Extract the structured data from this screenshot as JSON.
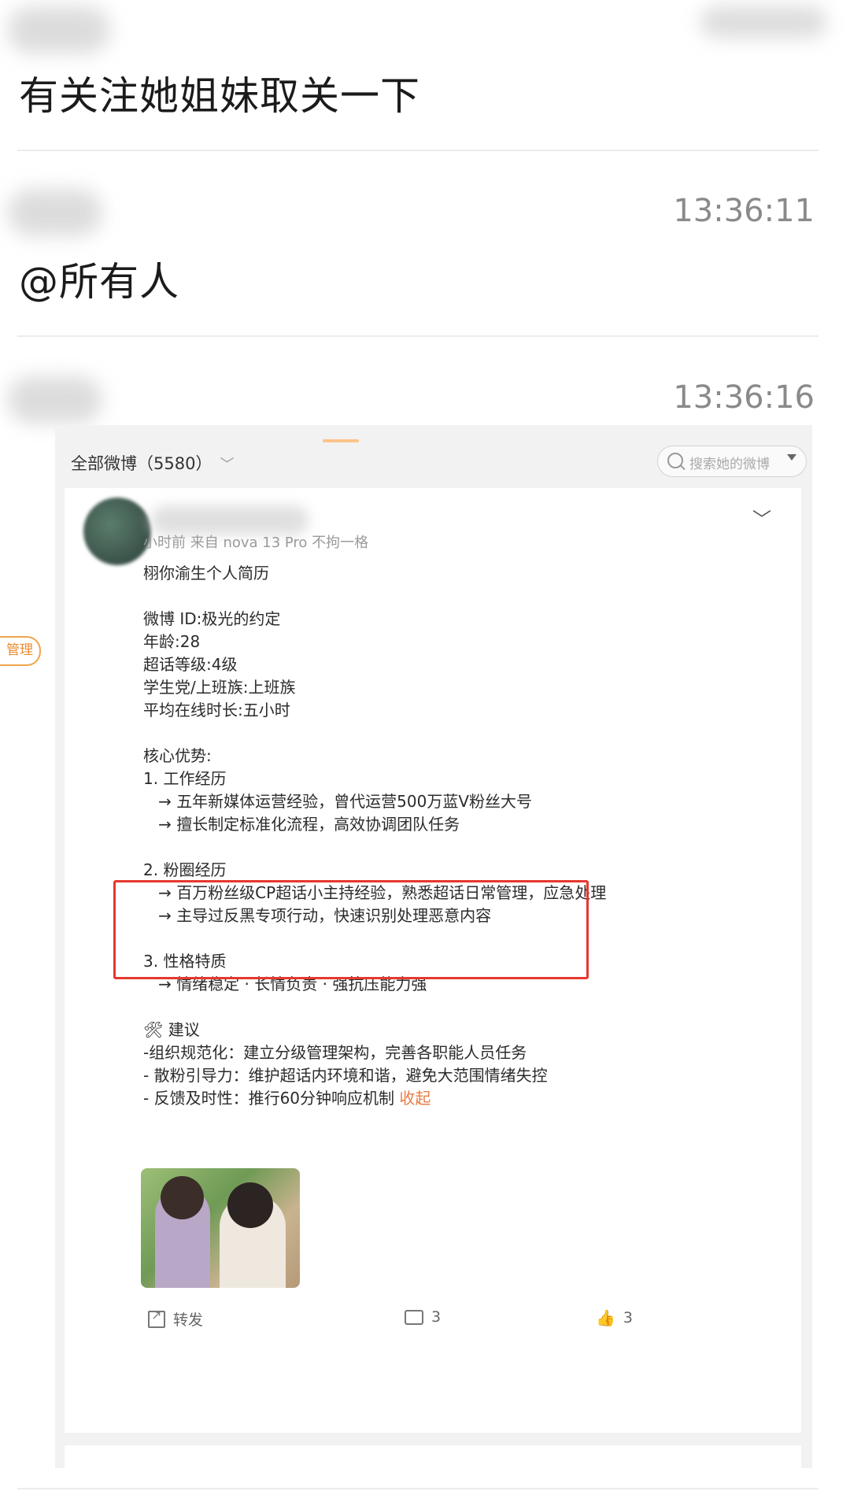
{
  "messages": [
    {
      "text": "有关注她姐妹取关一下",
      "time": ""
    },
    {
      "text": "@所有人",
      "time": "13:36:11"
    },
    {
      "text": "",
      "time": "13:36:16"
    }
  ],
  "side_tag": "管理",
  "shot": {
    "filter_label": "全部微博（5580）",
    "search_placeholder": "搜索她的微博",
    "post": {
      "meta": "小时前 来自 nova 13 Pro 不拘一格",
      "lines": [
        "栩你渝生个人简历",
        "",
        "微博 ID:极光的约定",
        "年龄:28",
        "超话等级:4级",
        "学生党/上班族:上班族",
        "平均在线时长:五小时",
        "",
        "核心优势:",
        "1. 工作经历",
        "   → 五年新媒体运营经验，曾代运营500万蓝V粉丝大号",
        "   → 擅长制定标准化流程，高效协调团队任务",
        "",
        "2. 粉圈经历",
        "   → 百万粉丝级CP超话小主持经验，熟悉超话日常管理，应急处理",
        "   → 主导过反黑专项行动，快速识别处理恶意内容",
        "",
        "3. 性格特质",
        "   → 情绪稳定 · 长情负责 · 强抗压能力强",
        "",
        "🛠 建议",
        "-组织规范化：建立分级管理架构，完善各职能人员任务",
        "- 散粉引导力：维护超话内环境和谐，避免大范围情绪失控",
        "- 反馈及时性：推行60分钟响应机制 "
      ],
      "collapse_label": "收起",
      "share_label": "转发",
      "comment_count": "3",
      "like_count": "3"
    }
  }
}
